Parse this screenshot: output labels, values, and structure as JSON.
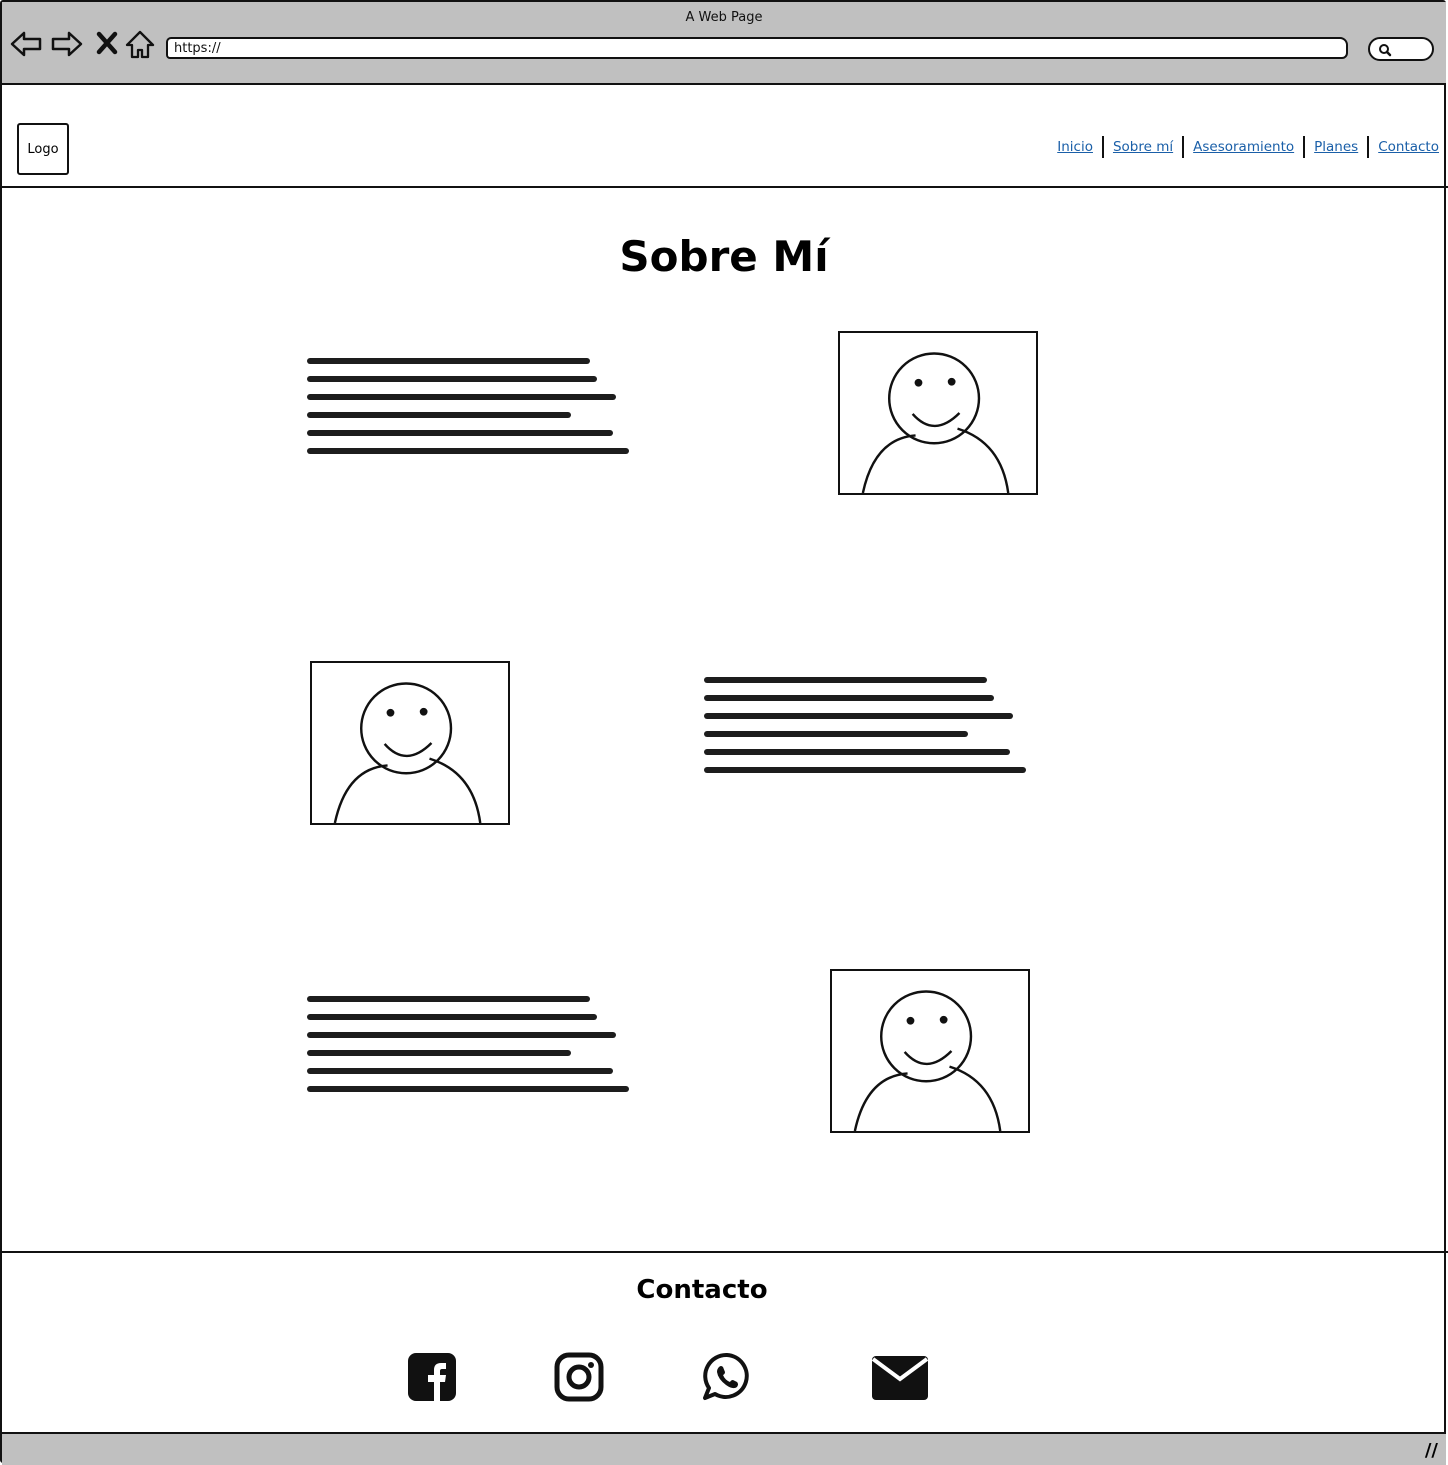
{
  "browser": {
    "window_title": "A Web Page",
    "url": "https://",
    "icons": [
      "back-arrow-icon",
      "forward-arrow-icon",
      "close-x-icon",
      "home-icon",
      "search-icon"
    ]
  },
  "header": {
    "logo": "Logo",
    "nav": [
      "Inicio",
      "Sobre mí",
      "Asesoramiento",
      "Planes",
      "Contacto"
    ]
  },
  "main": {
    "title": "Sobre Mí",
    "sections": [
      {
        "layout": "text-left-image-right",
        "image_icon": "user-avatar-icon"
      },
      {
        "layout": "image-left-text-right",
        "image_icon": "user-avatar-icon"
      },
      {
        "layout": "text-left-image-right",
        "image_icon": "user-avatar-icon"
      }
    ]
  },
  "footer": {
    "title": "Contacto",
    "social": [
      "facebook-icon",
      "instagram-icon",
      "whatsapp-icon",
      "email-icon"
    ]
  },
  "colors": {
    "chrome": "#c0c0c0",
    "link": "#1a5fa8",
    "ink": "#111111"
  }
}
